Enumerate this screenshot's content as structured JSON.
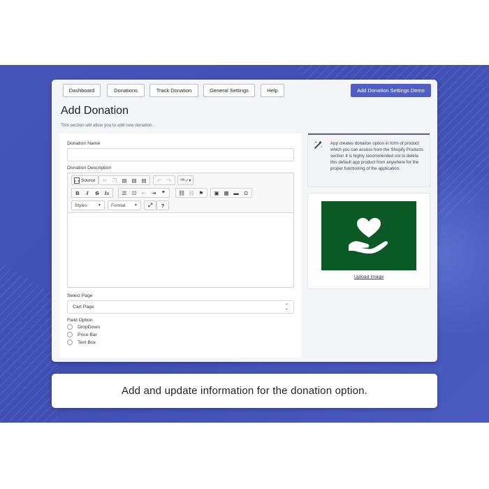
{
  "nav": {
    "buttons": [
      "Dashboard",
      "Donations",
      "Track Donation",
      "General Settings",
      "Help"
    ],
    "demo_button": "Add Donation Settings Demo"
  },
  "page": {
    "title": "Add Donation",
    "subtitle": "This section will allow you to add new donation."
  },
  "form": {
    "name_label": "Donation Name",
    "name_value": "",
    "description_label": "Donation Description",
    "toolbar": {
      "source_label": "Source",
      "styles_label": "Styles",
      "format_label": "Format",
      "icons": [
        "source-icon",
        "cut-icon",
        "copy-icon",
        "paste-icon",
        "paste-text-icon",
        "paste-word-icon",
        "undo-icon",
        "redo-icon",
        "spellcheck-icon",
        "bold-icon",
        "italic-icon",
        "strike-icon",
        "remove-format-icon",
        "numbered-list-icon",
        "bulleted-list-icon",
        "outdent-icon",
        "indent-icon",
        "blockquote-icon",
        "link-icon",
        "unlink-icon",
        "anchor-icon",
        "image-icon",
        "table-icon",
        "horizontal-line-icon",
        "special-char-icon",
        "maximize-icon",
        "help-icon"
      ]
    },
    "select_page_label": "Select Page",
    "select_page_value": "Cart Page",
    "field_option_label": "Field Option",
    "field_options": [
      "DropDown",
      "Price Bar",
      "Text Box"
    ]
  },
  "info": {
    "text": "App creates donation option in form of product which you can access from the Shopify Products section It is highly recommended not to delete this default app product from anywhere for the proper functioning of the application."
  },
  "image_panel": {
    "upload_label": "Upload Image",
    "image_background": "#0b5a26"
  },
  "caption": "Add and update information for the donation option.",
  "colors": {
    "band": "#4655b8",
    "accent_button": "#5160c0"
  }
}
